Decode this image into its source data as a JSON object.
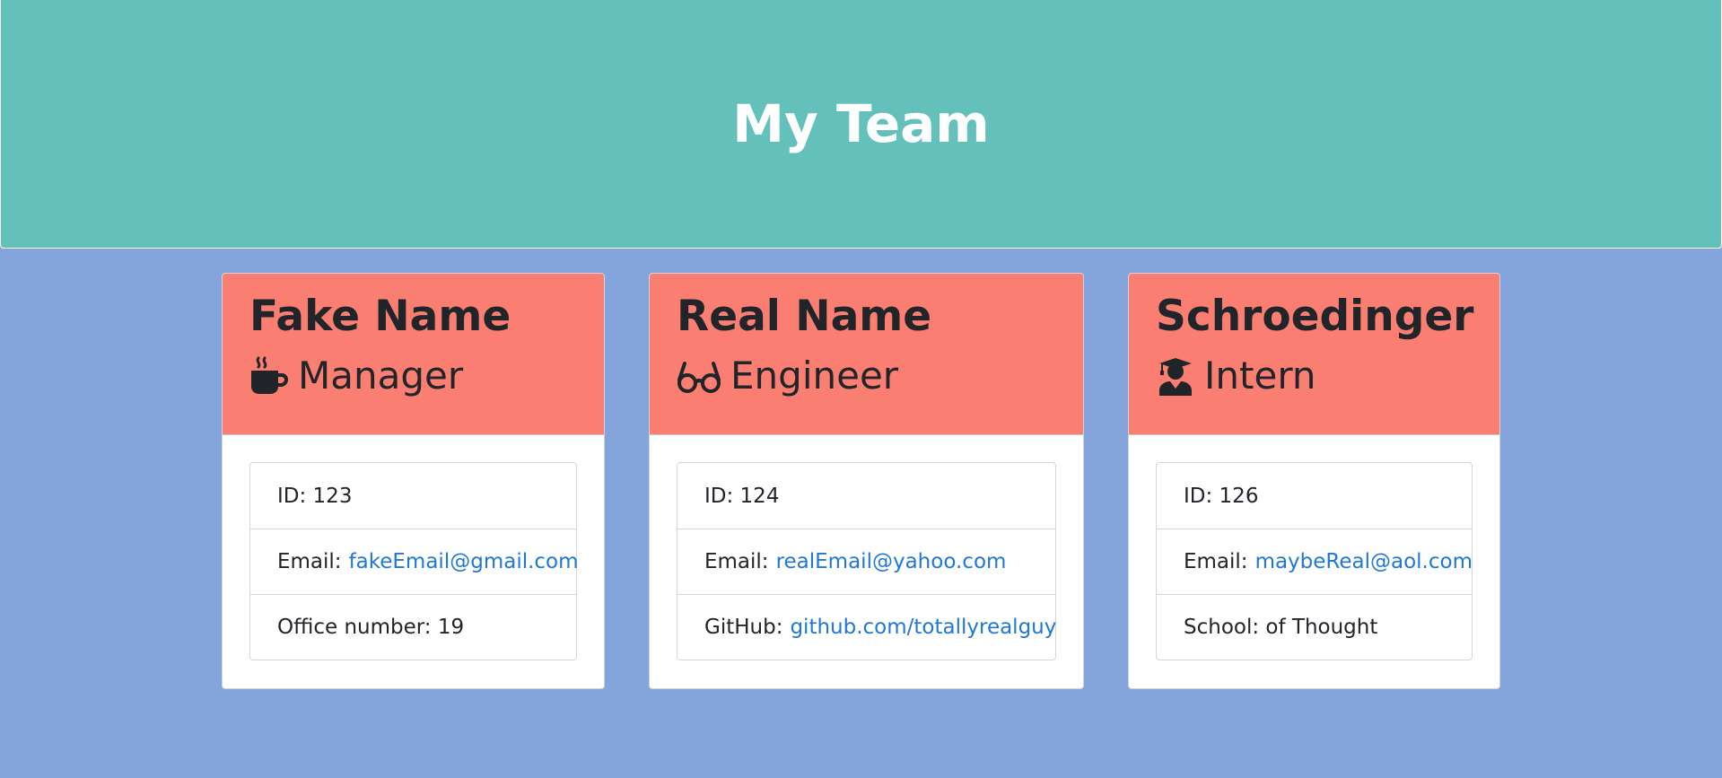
{
  "header": {
    "title": "My Team"
  },
  "colors": {
    "background": "#84a4dc",
    "header": "#63c0ba",
    "card_header": "#fa7f72",
    "link": "#1f78d8"
  },
  "cards": [
    {
      "name": "Fake Name",
      "role": "Manager",
      "role_icon": "coffee-mug-icon",
      "id_text": "ID: 123",
      "email_label": "Email:",
      "email": "fakeEmail@gmail.com",
      "extra_text": "Office number: 19"
    },
    {
      "name": "Real Name",
      "role": "Engineer",
      "role_icon": "glasses-icon",
      "id_text": "ID: 124",
      "email_label": "Email:",
      "email": "realEmail@yahoo.com",
      "extra_label": "GitHub:",
      "extra_link": "github.com/totallyrealguy"
    },
    {
      "name": "Schroedinger",
      "role": "Intern",
      "role_icon": "graduate-icon",
      "id_text": "ID: 126",
      "email_label": "Email:",
      "email": "maybeReal@aol.com",
      "extra_text": "School: of Thought"
    }
  ]
}
